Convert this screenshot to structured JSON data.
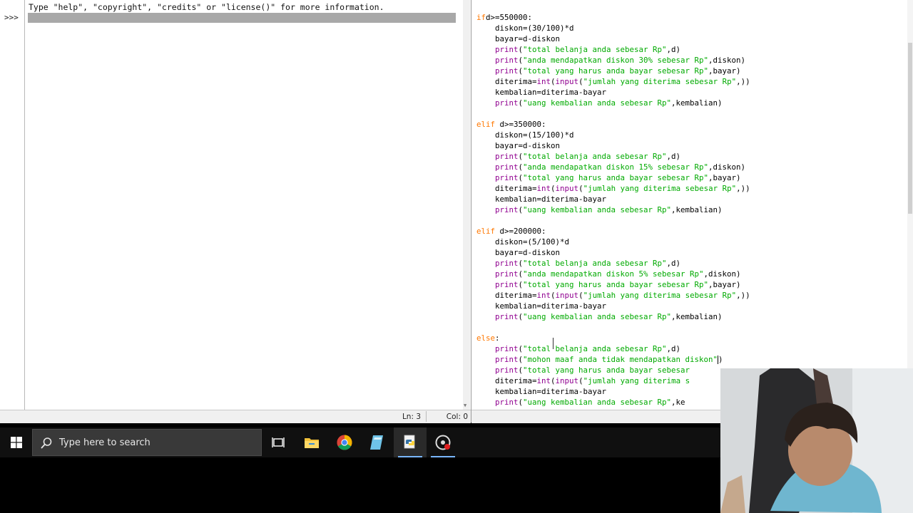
{
  "shell": {
    "banner": "Type \"help\", \"copyright\", \"credits\" or \"license()\" for more information.",
    "prompt": ">>>",
    "status_ln": "Ln: 3",
    "status_col": "Col: 0"
  },
  "editor": {
    "lines": [
      [
        [
          "kw",
          "if"
        ],
        [
          "",
          "d>=550000:"
        ]
      ],
      [
        [
          "",
          "    diskon=(30/100)*d"
        ]
      ],
      [
        [
          "",
          "    bayar=d-diskon"
        ]
      ],
      [
        [
          "bi",
          "    print"
        ],
        [
          "",
          "("
        ],
        [
          "st",
          "\"total belanja anda sebesar Rp\""
        ],
        [
          "",
          ",d)"
        ]
      ],
      [
        [
          "bi",
          "    print"
        ],
        [
          "",
          "("
        ],
        [
          "st",
          "\"anda mendapatkan diskon 30% sebesar Rp\""
        ],
        [
          "",
          ",diskon)"
        ]
      ],
      [
        [
          "bi",
          "    print"
        ],
        [
          "",
          "("
        ],
        [
          "st",
          "\"total yang harus anda bayar sebesar Rp\""
        ],
        [
          "",
          ",bayar)"
        ]
      ],
      [
        [
          "",
          "    diterima="
        ],
        [
          "bi",
          "int"
        ],
        [
          "",
          "("
        ],
        [
          "bi",
          "input"
        ],
        [
          "",
          "("
        ],
        [
          "st",
          "\"jumlah yang diterima sebesar Rp\""
        ],
        [
          "",
          ",))"
        ]
      ],
      [
        [
          "",
          "    kembalian=diterima-bayar"
        ]
      ],
      [
        [
          "bi",
          "    print"
        ],
        [
          "",
          "("
        ],
        [
          "st",
          "\"uang kembalian anda sebesar Rp\""
        ],
        [
          "",
          ",kembalian)"
        ]
      ],
      [],
      [
        [
          "kw",
          "elif"
        ],
        [
          "",
          " d>=350000:"
        ]
      ],
      [
        [
          "",
          "    diskon=(15/100)*d"
        ]
      ],
      [
        [
          "",
          "    bayar=d-diskon"
        ]
      ],
      [
        [
          "bi",
          "    print"
        ],
        [
          "",
          "("
        ],
        [
          "st",
          "\"total belanja anda sebesar Rp\""
        ],
        [
          "",
          ",d)"
        ]
      ],
      [
        [
          "bi",
          "    print"
        ],
        [
          "",
          "("
        ],
        [
          "st",
          "\"anda mendapatkan diskon 15% sebesar Rp\""
        ],
        [
          "",
          ",diskon)"
        ]
      ],
      [
        [
          "bi",
          "    print"
        ],
        [
          "",
          "("
        ],
        [
          "st",
          "\"total yang harus anda bayar sebesar Rp\""
        ],
        [
          "",
          ",bayar)"
        ]
      ],
      [
        [
          "",
          "    diterima="
        ],
        [
          "bi",
          "int"
        ],
        [
          "",
          "("
        ],
        [
          "bi",
          "input"
        ],
        [
          "",
          "("
        ],
        [
          "st",
          "\"jumlah yang diterima sebesar Rp\""
        ],
        [
          "",
          ",))"
        ]
      ],
      [
        [
          "",
          "    kembalian=diterima-bayar"
        ]
      ],
      [
        [
          "bi",
          "    print"
        ],
        [
          "",
          "("
        ],
        [
          "st",
          "\"uang kembalian anda sebesar Rp\""
        ],
        [
          "",
          ",kembalian)"
        ]
      ],
      [],
      [
        [
          "kw",
          "elif"
        ],
        [
          "",
          " d>=200000:"
        ]
      ],
      [
        [
          "",
          "    diskon=(5/100)*d"
        ]
      ],
      [
        [
          "",
          "    bayar=d-diskon"
        ]
      ],
      [
        [
          "bi",
          "    print"
        ],
        [
          "",
          "("
        ],
        [
          "st",
          "\"total belanja anda sebesar Rp\""
        ],
        [
          "",
          ",d)"
        ]
      ],
      [
        [
          "bi",
          "    print"
        ],
        [
          "",
          "("
        ],
        [
          "st",
          "\"anda mendapatkan diskon 5% sebesar Rp\""
        ],
        [
          "",
          ",diskon)"
        ]
      ],
      [
        [
          "bi",
          "    print"
        ],
        [
          "",
          "("
        ],
        [
          "st",
          "\"total yang harus anda bayar sebesar Rp\""
        ],
        [
          "",
          ",bayar)"
        ]
      ],
      [
        [
          "",
          "    diterima="
        ],
        [
          "bi",
          "int"
        ],
        [
          "",
          "("
        ],
        [
          "bi",
          "input"
        ],
        [
          "",
          "("
        ],
        [
          "st",
          "\"jumlah yang diterima sebesar Rp\""
        ],
        [
          "",
          ",))"
        ]
      ],
      [
        [
          "",
          "    kembalian=diterima-bayar"
        ]
      ],
      [
        [
          "bi",
          "    print"
        ],
        [
          "",
          "("
        ],
        [
          "st",
          "\"uang kembalian anda sebesar Rp\""
        ],
        [
          "",
          ",kembalian)"
        ]
      ],
      [],
      [
        [
          "kw",
          "else"
        ],
        [
          "",
          ":"
        ]
      ],
      [
        [
          "bi",
          "    print"
        ],
        [
          "",
          "("
        ],
        [
          "st",
          "\"total belanja anda sebesar Rp\""
        ],
        [
          "",
          ",d)"
        ]
      ],
      [
        [
          "bi",
          "    print"
        ],
        [
          "",
          "("
        ],
        [
          "st",
          "\"mohon maaf anda tidak mendapatkan diskon\""
        ],
        [
          "caret",
          ""
        ],
        [
          "",
          ")"
        ]
      ],
      [
        [
          "bi",
          "    print"
        ],
        [
          "",
          "("
        ],
        [
          "st",
          "\"total yang harus anda bayar sebesar"
        ]
      ],
      [
        [
          "",
          "    diterima="
        ],
        [
          "bi",
          "int"
        ],
        [
          "",
          "("
        ],
        [
          "bi",
          "input"
        ],
        [
          "",
          "("
        ],
        [
          "st",
          "\"jumlah yang diterima s"
        ]
      ],
      [
        [
          "",
          "    kembalian=diterima-bayar"
        ]
      ],
      [
        [
          "bi",
          "    print"
        ],
        [
          "",
          "("
        ],
        [
          "st",
          "\"uang kembalian anda sebesar Rp\""
        ],
        [
          "",
          ",ke"
        ]
      ]
    ]
  },
  "taskbar": {
    "search_placeholder": "Type here to search",
    "icons": [
      "windows-start-icon",
      "task-view-icon",
      "file-explorer-icon",
      "chrome-icon",
      "notepad-icon",
      "python-idle-icon",
      "obs-recorder-icon"
    ]
  },
  "colors": {
    "keyword": "#ff7700",
    "builtin": "#900090",
    "string": "#00aa00",
    "taskbar": "#101010"
  }
}
